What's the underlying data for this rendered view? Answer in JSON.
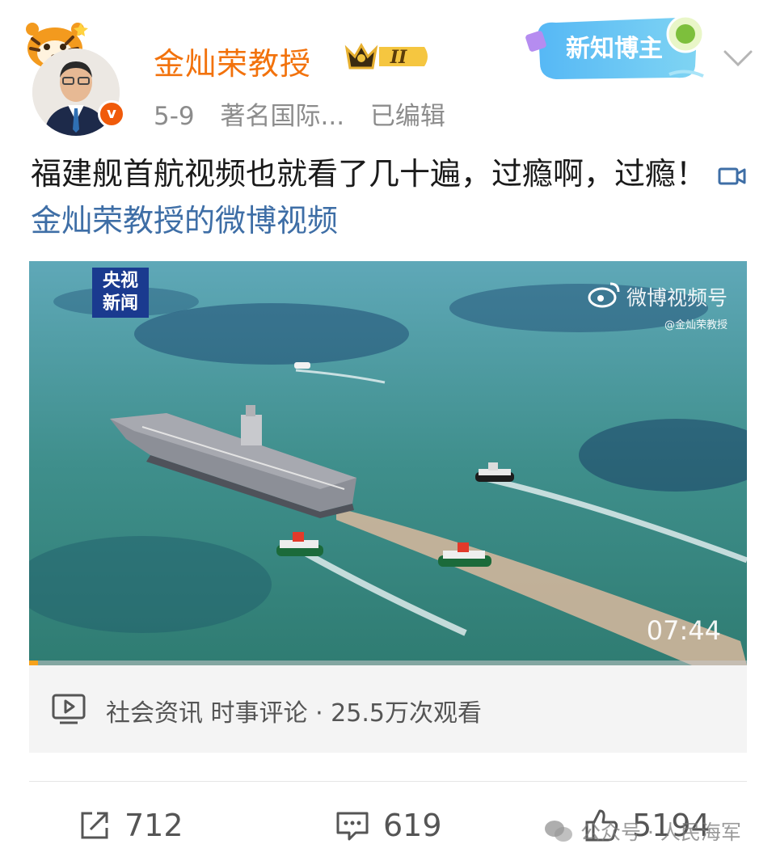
{
  "header": {
    "username": "金灿荣教授",
    "level": "II",
    "date": "5-9",
    "description": "著名国际...",
    "edited": "已编辑",
    "new_blogger_badge": "新知博主",
    "verified_mark": "v"
  },
  "post": {
    "text": "福建舰首航视频也就看了几十遍，过瘾啊，过瘾！",
    "video_link": "金灿荣教授的微博视频"
  },
  "video": {
    "channel_logo_line1": "央视",
    "channel_logo_line2": "新闻",
    "watermark_title": "微博视频号",
    "watermark_handle": "@金灿荣教授",
    "duration": "07:44",
    "progress": 0.012,
    "info": "社会资讯 时事评论 · 25.5万次观看"
  },
  "actions": {
    "share_count": "712",
    "comment_count": "619",
    "like_count": "5194"
  },
  "overlay": {
    "watermark": "公众号 · 人民海军"
  },
  "colors": {
    "username": "#f2720c",
    "link": "#3e6ea6",
    "verified": "#f05a0a",
    "progress": "#f7a21b"
  }
}
